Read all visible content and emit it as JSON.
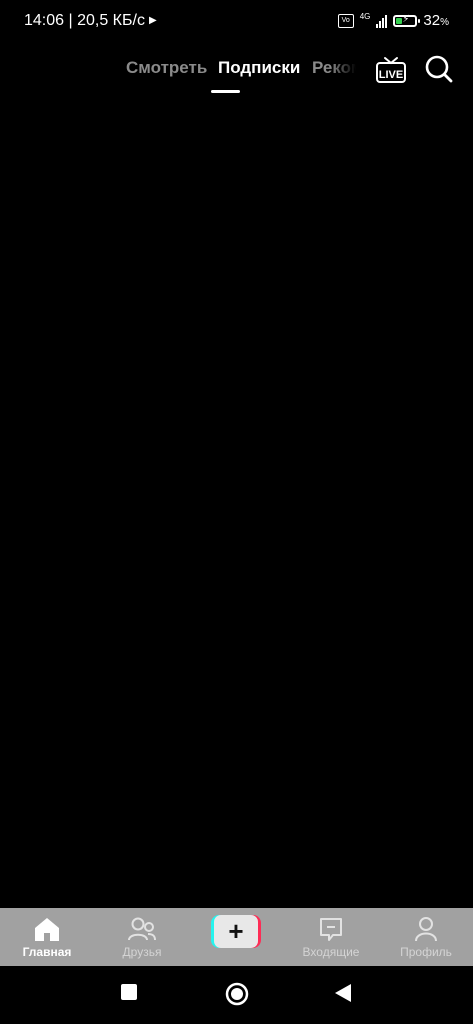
{
  "status_bar": {
    "time_speed": "14:06 | 20,5 КБ/с",
    "network": "4G",
    "battery_percent": "32",
    "battery_suffix": "%",
    "battery_level": 0.32,
    "battery_color": "#35d04f"
  },
  "top_tabs": [
    {
      "label": "Смотреть",
      "active": false
    },
    {
      "label": "Подписки",
      "active": true
    },
    {
      "label": "Реком",
      "active": false
    }
  ],
  "top_icons": {
    "live": "LIVE",
    "live_icon": "live-tv-icon",
    "search_icon": "search-icon"
  },
  "bottom_nav": [
    {
      "label": "Главная",
      "icon": "home-icon",
      "active": true
    },
    {
      "label": "Друзья",
      "icon": "friends-icon",
      "active": false
    },
    {
      "label": "+",
      "icon": "create-plus-icon",
      "active": false
    },
    {
      "label": "Входящие",
      "icon": "inbox-icon",
      "active": false
    },
    {
      "label": "Профиль",
      "icon": "profile-icon",
      "active": false
    }
  ],
  "colors": {
    "accent_cyan": "#25f4ee",
    "accent_pink": "#fe2c55",
    "nav_bg": "#a1a1a1"
  }
}
